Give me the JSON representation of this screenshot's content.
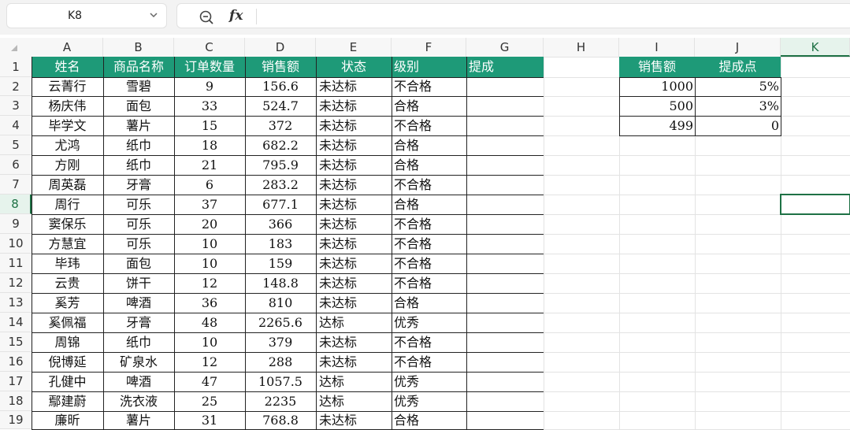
{
  "namebox": {
    "ref": "K8"
  },
  "formula_bar": {
    "fx_label": "fx",
    "value": ""
  },
  "columns": [
    "A",
    "B",
    "C",
    "D",
    "E",
    "F",
    "G",
    "H",
    "I",
    "J",
    "K"
  ],
  "rows": [
    "1",
    "2",
    "3",
    "4",
    "5",
    "6",
    "7",
    "8",
    "9",
    "10",
    "11",
    "12",
    "13",
    "14",
    "15",
    "16",
    "17",
    "18",
    "19"
  ],
  "selected": {
    "col": "K",
    "row": "8"
  },
  "main_table": {
    "headers": [
      "姓名",
      "商品名称",
      "订单数量",
      "销售额",
      "状态",
      "级别",
      "提成"
    ],
    "rows": [
      [
        "云菁行",
        "雪碧",
        "9",
        "156.6",
        "未达标",
        "不合格",
        ""
      ],
      [
        "杨庆伟",
        "面包",
        "33",
        "524.7",
        "未达标",
        "合格",
        ""
      ],
      [
        "毕学文",
        "薯片",
        "15",
        "372",
        "未达标",
        "不合格",
        ""
      ],
      [
        "尤鸿",
        "纸巾",
        "18",
        "682.2",
        "未达标",
        "合格",
        ""
      ],
      [
        "方刚",
        "纸巾",
        "21",
        "795.9",
        "未达标",
        "合格",
        ""
      ],
      [
        "周英磊",
        "牙膏",
        "6",
        "283.2",
        "未达标",
        "不合格",
        ""
      ],
      [
        "周行",
        "可乐",
        "37",
        "677.1",
        "未达标",
        "合格",
        ""
      ],
      [
        "窦保乐",
        "可乐",
        "20",
        "366",
        "未达标",
        "不合格",
        ""
      ],
      [
        "方慧宜",
        "可乐",
        "10",
        "183",
        "未达标",
        "不合格",
        ""
      ],
      [
        "毕玮",
        "面包",
        "10",
        "159",
        "未达标",
        "不合格",
        ""
      ],
      [
        "云贵",
        "饼干",
        "12",
        "148.8",
        "未达标",
        "不合格",
        ""
      ],
      [
        "奚芳",
        "啤酒",
        "36",
        "810",
        "未达标",
        "合格",
        ""
      ],
      [
        "奚佩福",
        "牙膏",
        "48",
        "2265.6",
        "达标",
        "优秀",
        ""
      ],
      [
        "周锦",
        "纸巾",
        "10",
        "379",
        "未达标",
        "不合格",
        ""
      ],
      [
        "倪博延",
        "矿泉水",
        "12",
        "288",
        "未达标",
        "不合格",
        ""
      ],
      [
        "孔健中",
        "啤酒",
        "47",
        "1057.5",
        "达标",
        "优秀",
        ""
      ],
      [
        "鄢建蔚",
        "洗衣液",
        "25",
        "2235",
        "达标",
        "优秀",
        ""
      ],
      [
        "廉昕",
        "薯片",
        "31",
        "768.8",
        "未达标",
        "合格",
        ""
      ]
    ]
  },
  "lookup_table": {
    "headers": [
      "销售额",
      "提成点"
    ],
    "rows": [
      [
        "1000",
        "5%"
      ],
      [
        "500",
        "3%"
      ],
      [
        "499",
        "0"
      ]
    ]
  },
  "colors": {
    "header_fill": "#1e9a78",
    "selection": "#1e7145"
  }
}
